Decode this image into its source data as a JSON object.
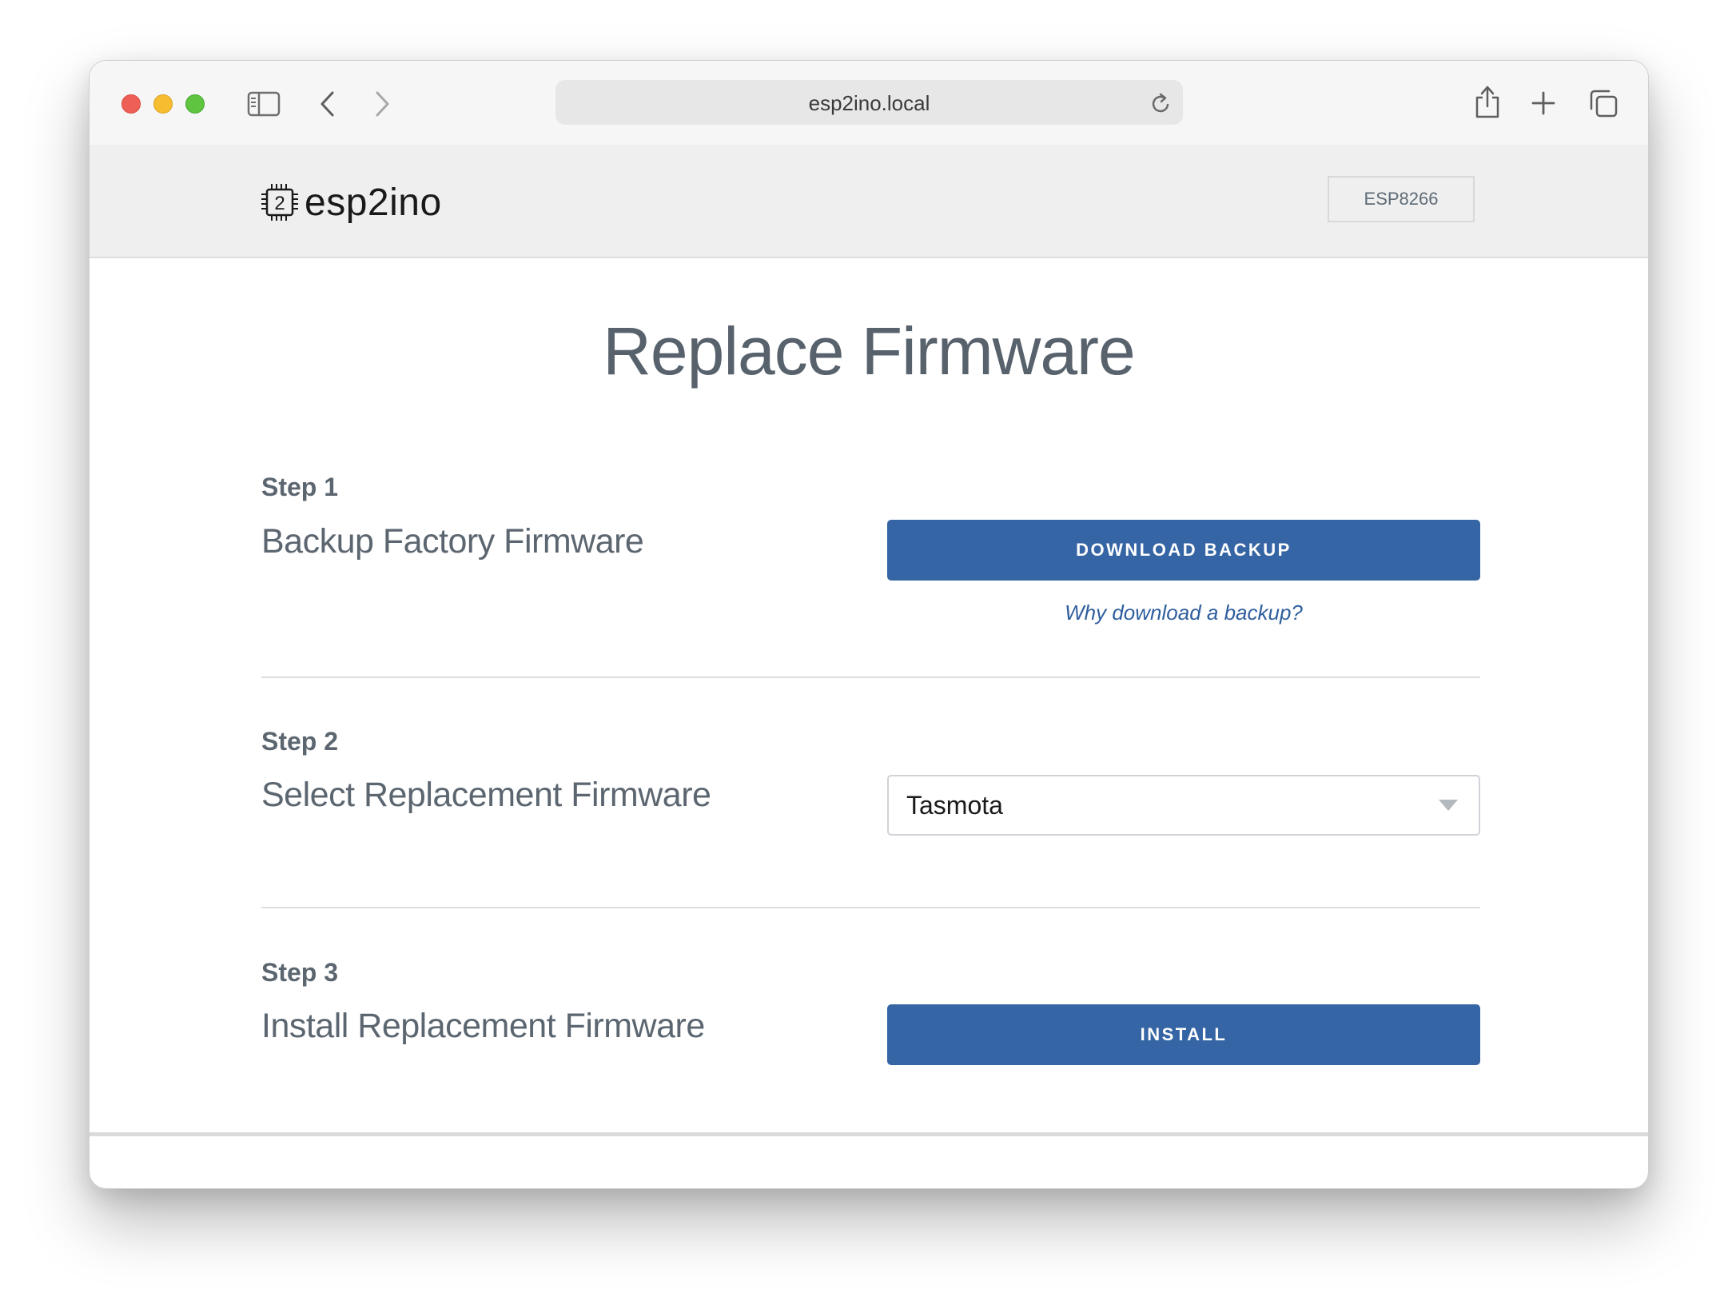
{
  "browser": {
    "address": "esp2ino.local",
    "icons": [
      "sidebar-icon",
      "back-icon",
      "forward-icon",
      "reload-icon",
      "share-icon",
      "new-tab-icon",
      "tabs-overview-icon"
    ]
  },
  "header": {
    "logo_glyph": "2",
    "logo_text": "esp2ino",
    "device": "ESP8266"
  },
  "main": {
    "title": "Replace Firmware",
    "steps": [
      {
        "label": "Step 1",
        "title": "Backup Factory Firmware",
        "button": "DOWNLOAD BACKUP",
        "link": "Why download a backup?"
      },
      {
        "label": "Step 2",
        "title": "Select Replacement Firmware",
        "selected": "Tasmota"
      },
      {
        "label": "Step 3",
        "title": "Install Replacement Firmware",
        "button": "INSTALL"
      }
    ]
  },
  "colors": {
    "primary": "#3565a4",
    "text": "#5c6670",
    "link": "#2f5f9e"
  }
}
